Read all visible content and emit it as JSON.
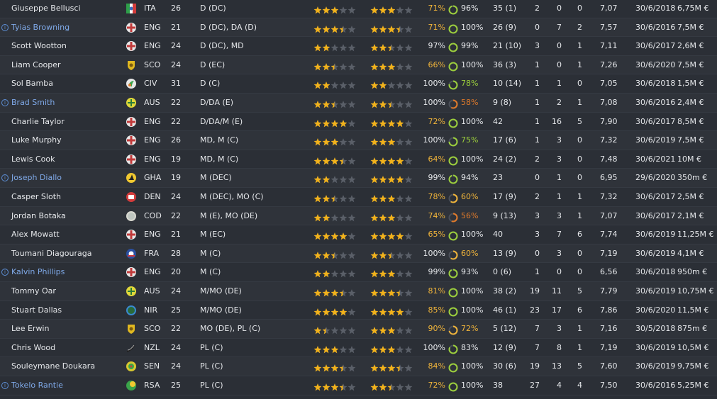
{
  "colors": {
    "background": "#2b2f36",
    "loan_name": "#7fa9e8",
    "star_full": "#f2b21b",
    "star_empty": "#5a5f68",
    "fitness_good": "#9ccf3c",
    "fitness_mid": "#f0b43a",
    "fitness_low": "#e07a2a"
  },
  "players": [
    {
      "name": "Giuseppe Bellusci",
      "loan": false,
      "flag": "ita",
      "nat": "ITA",
      "age": "26",
      "pos": "D (DC)",
      "ability": 3,
      "potential": 3,
      "cond": "71%",
      "cond_class": "mid",
      "ring": 0.96,
      "sharp": "96%",
      "sharp_class": "white",
      "apps": "35 (1)",
      "goals": "2",
      "assists": "0",
      "pom": "0",
      "rating": "7,07",
      "contract": "30/6/2018",
      "value": "6,75M €"
    },
    {
      "name": "Tyias Browning",
      "loan": true,
      "flag": "eng",
      "nat": "ENG",
      "age": "21",
      "pos": "D (DC), DA (D)",
      "ability": 3.5,
      "potential": 3.5,
      "cond": "71%",
      "cond_class": "mid",
      "ring": 1.0,
      "sharp": "100%",
      "sharp_class": "white",
      "apps": "26 (9)",
      "goals": "0",
      "assists": "7",
      "pom": "2",
      "rating": "7,57",
      "contract": "30/6/2016",
      "value": "7,5M €"
    },
    {
      "name": "Scott Wootton",
      "loan": false,
      "flag": "eng",
      "nat": "ENG",
      "age": "24",
      "pos": "D (DC), MD",
      "ability": 2,
      "potential": 2.5,
      "cond": "97%",
      "cond_class": "white",
      "ring": 0.99,
      "sharp": "99%",
      "sharp_class": "white",
      "apps": "21 (10)",
      "goals": "3",
      "assists": "0",
      "pom": "1",
      "rating": "7,11",
      "contract": "30/6/2017",
      "value": "2,6M €"
    },
    {
      "name": "Liam Cooper",
      "loan": false,
      "flag": "sco",
      "nat": "SCO",
      "age": "24",
      "pos": "D (EC)",
      "ability": 2.5,
      "potential": 3,
      "cond": "66%",
      "cond_class": "mid",
      "ring": 1.0,
      "sharp": "100%",
      "sharp_class": "white",
      "apps": "36 (3)",
      "goals": "1",
      "assists": "0",
      "pom": "1",
      "rating": "7,26",
      "contract": "30/6/2020",
      "value": "7,5M €"
    },
    {
      "name": "Sol Bamba",
      "loan": false,
      "flag": "civ",
      "nat": "CIV",
      "age": "31",
      "pos": "D (C)",
      "ability": 2,
      "potential": 2,
      "cond": "100%",
      "cond_class": "white",
      "ring": 0.78,
      "sharp": "78%",
      "sharp_class": "good",
      "apps": "10 (14)",
      "goals": "1",
      "assists": "1",
      "pom": "0",
      "rating": "7,05",
      "contract": "30/6/2018",
      "value": "1,5M €"
    },
    {
      "name": "Brad Smith",
      "loan": true,
      "flag": "aus",
      "nat": "AUS",
      "age": "22",
      "pos": "D/DA (E)",
      "ability": 2.5,
      "potential": 2.5,
      "cond": "100%",
      "cond_class": "white",
      "ring": 0.58,
      "sharp": "58%",
      "sharp_class": "bad",
      "apps": "9 (8)",
      "goals": "1",
      "assists": "2",
      "pom": "1",
      "rating": "7,08",
      "contract": "30/6/2016",
      "value": "2,4M €"
    },
    {
      "name": "Charlie Taylor",
      "loan": false,
      "flag": "eng",
      "nat": "ENG",
      "age": "22",
      "pos": "D/DA/M (E)",
      "ability": 4,
      "potential": 4,
      "cond": "72%",
      "cond_class": "mid",
      "ring": 1.0,
      "sharp": "100%",
      "sharp_class": "white",
      "apps": "42",
      "goals": "1",
      "assists": "16",
      "pom": "5",
      "rating": "7,90",
      "contract": "30/6/2017",
      "value": "8,5M €"
    },
    {
      "name": "Luke Murphy",
      "loan": false,
      "flag": "eng",
      "nat": "ENG",
      "age": "26",
      "pos": "MD, M (C)",
      "ability": 3,
      "potential": 3,
      "cond": "100%",
      "cond_class": "white",
      "ring": 0.75,
      "sharp": "75%",
      "sharp_class": "good",
      "apps": "17 (6)",
      "goals": "1",
      "assists": "3",
      "pom": "0",
      "rating": "7,32",
      "contract": "30/6/2019",
      "value": "7,5M €"
    },
    {
      "name": "Lewis Cook",
      "loan": false,
      "flag": "eng",
      "nat": "ENG",
      "age": "19",
      "pos": "MD, M (C)",
      "ability": 3.5,
      "potential": 4,
      "cond": "64%",
      "cond_class": "mid",
      "ring": 1.0,
      "sharp": "100%",
      "sharp_class": "white",
      "apps": "24 (2)",
      "goals": "2",
      "assists": "3",
      "pom": "0",
      "rating": "7,48",
      "contract": "30/6/2021",
      "value": "10M €"
    },
    {
      "name": "Joseph Diallo",
      "loan": true,
      "flag": "gha",
      "nat": "GHA",
      "age": "19",
      "pos": "M (DEC)",
      "ability": 2,
      "potential": 4,
      "cond": "99%",
      "cond_class": "white",
      "ring": 0.94,
      "sharp": "94%",
      "sharp_class": "white",
      "apps": "23",
      "goals": "0",
      "assists": "1",
      "pom": "0",
      "rating": "6,95",
      "contract": "29/6/2020",
      "value": "350m €"
    },
    {
      "name": "Casper Sloth",
      "loan": false,
      "flag": "den",
      "nat": "DEN",
      "age": "24",
      "pos": "M (DEC), MO (C)",
      "ability": 2.5,
      "potential": 3,
      "cond": "78%",
      "cond_class": "mid",
      "ring": 0.6,
      "sharp": "60%",
      "sharp_class": "mid",
      "apps": "17 (9)",
      "goals": "2",
      "assists": "1",
      "pom": "1",
      "rating": "7,32",
      "contract": "30/6/2017",
      "value": "2,5M €"
    },
    {
      "name": "Jordan Botaka",
      "loan": false,
      "flag": "cod",
      "nat": "COD",
      "age": "22",
      "pos": "M (E), MO (DE)",
      "ability": 2,
      "potential": 3,
      "cond": "74%",
      "cond_class": "mid",
      "ring": 0.56,
      "sharp": "56%",
      "sharp_class": "bad",
      "apps": "9 (13)",
      "goals": "3",
      "assists": "3",
      "pom": "1",
      "rating": "7,07",
      "contract": "30/6/2017",
      "value": "2,1M €"
    },
    {
      "name": "Alex Mowatt",
      "loan": false,
      "flag": "eng",
      "nat": "ENG",
      "age": "21",
      "pos": "M (EC)",
      "ability": 4,
      "potential": 4,
      "cond": "65%",
      "cond_class": "mid",
      "ring": 1.0,
      "sharp": "100%",
      "sharp_class": "white",
      "apps": "40",
      "goals": "3",
      "assists": "7",
      "pom": "6",
      "rating": "7,74",
      "contract": "30/6/2019",
      "value": "11,25M €"
    },
    {
      "name": "Toumani Diagouraga",
      "loan": false,
      "flag": "fra",
      "nat": "FRA",
      "age": "28",
      "pos": "M (C)",
      "ability": 2.5,
      "potential": 2.5,
      "cond": "100%",
      "cond_class": "white",
      "ring": 0.6,
      "sharp": "60%",
      "sharp_class": "mid",
      "apps": "13 (9)",
      "goals": "0",
      "assists": "3",
      "pom": "0",
      "rating": "7,19",
      "contract": "30/6/2019",
      "value": "4,1M €"
    },
    {
      "name": "Kalvin Phillips",
      "loan": true,
      "flag": "eng",
      "nat": "ENG",
      "age": "20",
      "pos": "M (C)",
      "ability": 2,
      "potential": 3,
      "cond": "99%",
      "cond_class": "white",
      "ring": 0.93,
      "sharp": "93%",
      "sharp_class": "white",
      "apps": "0 (6)",
      "goals": "1",
      "assists": "0",
      "pom": "0",
      "rating": "6,56",
      "contract": "30/6/2018",
      "value": "950m €"
    },
    {
      "name": "Tommy Oar",
      "loan": false,
      "flag": "aus",
      "nat": "AUS",
      "age": "24",
      "pos": "M/MO (DE)",
      "ability": 3.5,
      "potential": 3.5,
      "cond": "81%",
      "cond_class": "mid",
      "ring": 1.0,
      "sharp": "100%",
      "sharp_class": "white",
      "apps": "38 (2)",
      "goals": "19",
      "assists": "11",
      "pom": "5",
      "rating": "7,79",
      "contract": "30/6/2019",
      "value": "10,75M €"
    },
    {
      "name": "Stuart Dallas",
      "loan": false,
      "flag": "nir",
      "nat": "NIR",
      "age": "25",
      "pos": "M/MO (DE)",
      "ability": 4,
      "potential": 4,
      "cond": "85%",
      "cond_class": "mid",
      "ring": 1.0,
      "sharp": "100%",
      "sharp_class": "white",
      "apps": "46 (1)",
      "goals": "23",
      "assists": "17",
      "pom": "6",
      "rating": "7,86",
      "contract": "30/6/2020",
      "value": "11,5M €"
    },
    {
      "name": "Lee Erwin",
      "loan": false,
      "flag": "sco",
      "nat": "SCO",
      "age": "22",
      "pos": "MO (DE), PL (C)",
      "ability": 1.5,
      "potential": 3,
      "cond": "90%",
      "cond_class": "mid",
      "ring": 0.72,
      "sharp": "72%",
      "sharp_class": "mid",
      "apps": "5 (12)",
      "goals": "7",
      "assists": "3",
      "pom": "1",
      "rating": "7,16",
      "contract": "30/5/2018",
      "value": "875m €"
    },
    {
      "name": "Chris Wood",
      "loan": false,
      "flag": "nzl",
      "nat": "NZL",
      "age": "24",
      "pos": "PL (C)",
      "ability": 3,
      "potential": 3,
      "cond": "100%",
      "cond_class": "white",
      "ring": 0.83,
      "sharp": "83%",
      "sharp_class": "white",
      "apps": "12 (9)",
      "goals": "7",
      "assists": "8",
      "pom": "1",
      "rating": "7,19",
      "contract": "30/6/2019",
      "value": "10,5M €"
    },
    {
      "name": "Souleymane Doukara",
      "loan": false,
      "flag": "sen",
      "nat": "SEN",
      "age": "24",
      "pos": "PL (C)",
      "ability": 3.5,
      "potential": 3.5,
      "cond": "84%",
      "cond_class": "mid",
      "ring": 1.0,
      "sharp": "100%",
      "sharp_class": "white",
      "apps": "30 (6)",
      "goals": "19",
      "assists": "13",
      "pom": "5",
      "rating": "7,60",
      "contract": "30/6/2019",
      "value": "9,75M €"
    },
    {
      "name": "Tokelo Rantie",
      "loan": true,
      "flag": "rsa",
      "nat": "RSA",
      "age": "25",
      "pos": "PL (C)",
      "ability": 3.5,
      "potential": 2.5,
      "cond": "72%",
      "cond_class": "mid",
      "ring": 1.0,
      "sharp": "100%",
      "sharp_class": "white",
      "apps": "38",
      "goals": "27",
      "assists": "4",
      "pom": "4",
      "rating": "7,50",
      "contract": "30/6/2016",
      "value": "5,25M €"
    }
  ]
}
